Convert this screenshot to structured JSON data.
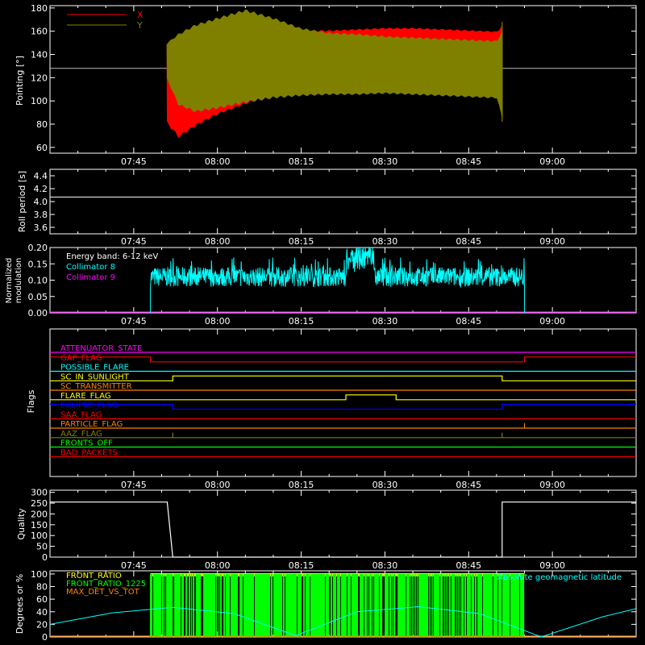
{
  "chart_data": [
    {
      "id": "pointing",
      "type": "line",
      "ylabel": "Pointing [°]",
      "ylim": [
        55,
        182
      ],
      "yticks": [
        60,
        80,
        100,
        120,
        140,
        160,
        180
      ],
      "xticks": [
        "07:45",
        "08:00",
        "08:15",
        "08:30",
        "08:45",
        "09:00"
      ],
      "grid": false,
      "legend": "top-left",
      "reference_line": 128,
      "series": [
        {
          "name": "X",
          "color": "#ff0000",
          "x": [
            "07:51",
            "07:53",
            "07:56",
            "08:00",
            "08:05",
            "08:10",
            "08:15",
            "08:20",
            "08:25",
            "08:30",
            "08:35",
            "08:40",
            "08:45",
            "08:50",
            "08:51"
          ],
          "max": [
            150,
            152,
            154,
            157,
            160,
            160,
            161,
            161,
            162,
            163,
            163,
            162,
            161,
            160,
            165
          ],
          "min": [
            80,
            68,
            78,
            88,
            97,
            105,
            113,
            118,
            121,
            123,
            124,
            126,
            126,
            127,
            85
          ]
        },
        {
          "name": "Y",
          "color": "#808000",
          "x": [
            "07:51",
            "07:53",
            "07:56",
            "08:00",
            "08:05",
            "08:10",
            "08:15",
            "08:20",
            "08:25",
            "08:30",
            "08:35",
            "08:40",
            "08:45",
            "08:50",
            "08:51"
          ],
          "max": [
            150,
            158,
            166,
            172,
            179,
            172,
            163,
            159,
            158,
            156,
            155,
            154,
            153,
            152,
            160
          ],
          "min": [
            118,
            96,
            90,
            93,
            98,
            102,
            104,
            105,
            105,
            106,
            105,
            104,
            103,
            102,
            85
          ]
        }
      ]
    },
    {
      "id": "roll",
      "type": "line",
      "ylabel": "Roll period [s]",
      "ylim": [
        3.5,
        4.5
      ],
      "yticks": [
        3.6,
        3.8,
        4.0,
        4.2,
        4.4
      ],
      "xticks": [
        "07:45",
        "08:00",
        "08:15",
        "08:30",
        "08:45",
        "09:00"
      ],
      "series": [
        {
          "name": "",
          "color": "#ffffff",
          "x": [
            "07:30",
            "09:15"
          ],
          "values": [
            4.07,
            4.07
          ]
        }
      ]
    },
    {
      "id": "modulation",
      "type": "line",
      "ylabel": "Normalized modulation",
      "ylim": [
        0,
        0.2
      ],
      "yticks": [
        0.0,
        0.05,
        0.1,
        0.15,
        0.2
      ],
      "xticks": [
        "07:45",
        "08:00",
        "08:15",
        "08:30",
        "08:45",
        "09:00"
      ],
      "annotation": "Energy band: 6-12 keV",
      "legend": "top-left",
      "series": [
        {
          "name": "Collimator 8",
          "color": "#00ffff",
          "x": [
            "07:48",
            "08:24",
            "08:24",
            "08:55"
          ],
          "values": [
            0.11,
            0.11,
            0.2,
            0.11
          ],
          "noise_range": [
            0.08,
            0.14
          ]
        },
        {
          "name": "Collimator 9",
          "color": "#ff00ff",
          "x": [
            "07:30",
            "09:15"
          ],
          "values": [
            0,
            0
          ]
        }
      ]
    },
    {
      "id": "flags",
      "type": "line",
      "ylabel": "Flags",
      "xticks": [
        "07:45",
        "08:00",
        "08:15",
        "08:30",
        "08:45",
        "09:00"
      ],
      "series": [
        {
          "name": "ATTENUATOR_STATE",
          "color": "#ff00ff",
          "x": [
            "07:30",
            "09:15"
          ],
          "values": [
            0,
            0
          ]
        },
        {
          "name": "GAP_FLAG",
          "color": "#ff0000",
          "x": [
            "07:30",
            "07:48",
            "07:48",
            "08:55",
            "08:55",
            "09:15"
          ],
          "values": [
            1,
            1,
            0,
            0,
            1,
            1
          ]
        },
        {
          "name": "POSSIBLE_FLARE",
          "color": "#00ffff",
          "x": [
            "07:30",
            "09:15"
          ],
          "values": [
            0,
            0
          ]
        },
        {
          "name": "SC_IN_SUNLIGHT",
          "color": "#ffff00",
          "x": [
            "07:30",
            "07:52",
            "07:52",
            "08:51",
            "08:51",
            "09:15"
          ],
          "values": [
            0,
            0,
            1,
            1,
            0,
            0
          ]
        },
        {
          "name": "SC_TRANSMITTER",
          "color": "#ff8000",
          "x": [
            "07:30",
            "09:15"
          ],
          "values": [
            0,
            0
          ]
        },
        {
          "name": "FLARE_FLAG",
          "color": "#ffff00",
          "x": [
            "07:30",
            "08:23",
            "08:23",
            "08:32",
            "08:32",
            "09:15"
          ],
          "values": [
            0,
            0,
            1,
            1,
            0,
            0
          ]
        },
        {
          "name": "ECLIPSE_FLAG",
          "color": "#0000ff",
          "x": [
            "07:30",
            "07:52",
            "07:52",
            "08:51",
            "08:51",
            "09:15"
          ],
          "values": [
            1,
            1,
            0,
            0,
            1,
            1
          ]
        },
        {
          "name": "SAA_FLAG",
          "color": "#ff0000",
          "x": [
            "07:30",
            "09:15"
          ],
          "values": [
            0,
            0
          ]
        },
        {
          "name": "PARTICLE_FLAG",
          "color": "#ff8000",
          "x": [
            "07:30",
            "08:55",
            "08:55",
            "08:55",
            "08:55",
            "09:15"
          ],
          "values": [
            0,
            0,
            1,
            1,
            0,
            0
          ]
        },
        {
          "name": "AAZ_FLAG",
          "color": "#808000",
          "x": [
            "07:30",
            "07:52",
            "07:52",
            "07:52",
            "07:52",
            "08:51",
            "08:51",
            "08:51",
            "08:51",
            "09:15"
          ],
          "values": [
            0,
            0,
            1,
            1,
            0,
            0,
            1,
            1,
            0,
            0
          ]
        },
        {
          "name": "FRONTS_OFF",
          "color": "#00ff00",
          "x": [
            "07:30",
            "09:15"
          ],
          "values": [
            0,
            0
          ]
        },
        {
          "name": "BAD_PACKETS",
          "color": "#ff0000",
          "x": [
            "07:30",
            "09:15"
          ],
          "values": [
            0,
            0
          ]
        }
      ]
    },
    {
      "id": "quality",
      "type": "line",
      "ylabel": "Quality",
      "ylim": [
        0,
        310
      ],
      "yticks": [
        0,
        50,
        100,
        150,
        200,
        250,
        300
      ],
      "xticks": [
        "07:45",
        "08:00",
        "08:15",
        "08:30",
        "08:45",
        "09:00"
      ],
      "series": [
        {
          "name": "",
          "color": "#ffffff",
          "x": [
            "07:30",
            "07:51",
            "07:52",
            "08:51",
            "08:51",
            "09:15"
          ],
          "values": [
            255,
            255,
            0,
            0,
            255,
            255
          ]
        }
      ]
    },
    {
      "id": "front_ratio",
      "type": "bar",
      "ylabel": "Degrees or %",
      "ylim": [
        0,
        105
      ],
      "yticks": [
        0,
        20,
        40,
        60,
        80,
        100
      ],
      "xticks": [
        "07:45",
        "08:00",
        "08:15",
        "08:30",
        "08:45",
        "09:00"
      ],
      "legend_right": "Absolute geomagnetic latitude",
      "series": [
        {
          "name": "FRONT_RATIO",
          "color": "#ffff00",
          "x": [
            "07:48",
            "08:55"
          ],
          "values": [
            100,
            100
          ]
        },
        {
          "name": "FRONT_RATIO_1225",
          "color": "#00ff00",
          "x": [
            "07:48",
            "08:55"
          ],
          "values": [
            100,
            100
          ]
        },
        {
          "name": "MAX_DET_VS_TOT",
          "color": "#ff8000",
          "x": [
            "07:30",
            "09:15"
          ],
          "values": [
            0,
            0
          ]
        },
        {
          "name": "Absolute geomagnetic latitude",
          "color": "#00ffff",
          "x": [
            "07:30",
            "07:41",
            "07:52",
            "08:03",
            "08:14",
            "08:25",
            "08:36",
            "08:47",
            "08:58",
            "09:09",
            "09:15"
          ],
          "values": [
            20,
            38,
            47,
            37,
            2,
            40,
            48,
            37,
            0,
            32,
            45
          ]
        }
      ]
    }
  ]
}
